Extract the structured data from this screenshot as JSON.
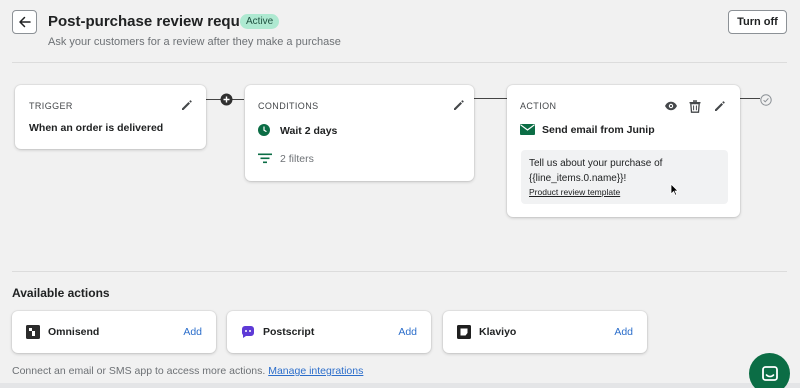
{
  "header": {
    "title": "Post-purchase review request",
    "status": "Active",
    "subtitle": "Ask your customers for a review after they make a purchase",
    "turn_off_label": "Turn off"
  },
  "workflow": {
    "trigger": {
      "label": "TRIGGER",
      "value": "When an order is delivered"
    },
    "conditions": {
      "label": "CONDITIONS",
      "wait": "Wait 2 days",
      "filters": "2 filters"
    },
    "action": {
      "label": "ACTION",
      "title": "Send email from Junip",
      "message_line1": "Tell us about your purchase of",
      "message_line2": "{{line_items.0.name}}!",
      "template_link": "Product review template"
    }
  },
  "available_actions": {
    "title": "Available actions",
    "items": [
      {
        "name": "Omnisend",
        "add_label": "Add"
      },
      {
        "name": "Postscript",
        "add_label": "Add"
      },
      {
        "name": "Klaviyo",
        "add_label": "Add"
      }
    ]
  },
  "footer": {
    "text": "Connect an email or SMS app to access more actions.",
    "link": "Manage integrations"
  },
  "colors": {
    "badge_bg": "#aee9d1",
    "accent_green": "#0b6d45",
    "link_blue": "#2c6ecb",
    "postscript_purple": "#5e3ad6"
  },
  "icons": {
    "back": "arrow-left-icon",
    "edit": "pencil-icon",
    "add_step": "plus-circle-icon",
    "wait": "clock-icon",
    "filter": "filter-icon",
    "email": "envelope-icon",
    "preview": "eye-icon",
    "delete": "trash-icon",
    "end": "check-circle-icon",
    "chat": "chat-icon"
  }
}
